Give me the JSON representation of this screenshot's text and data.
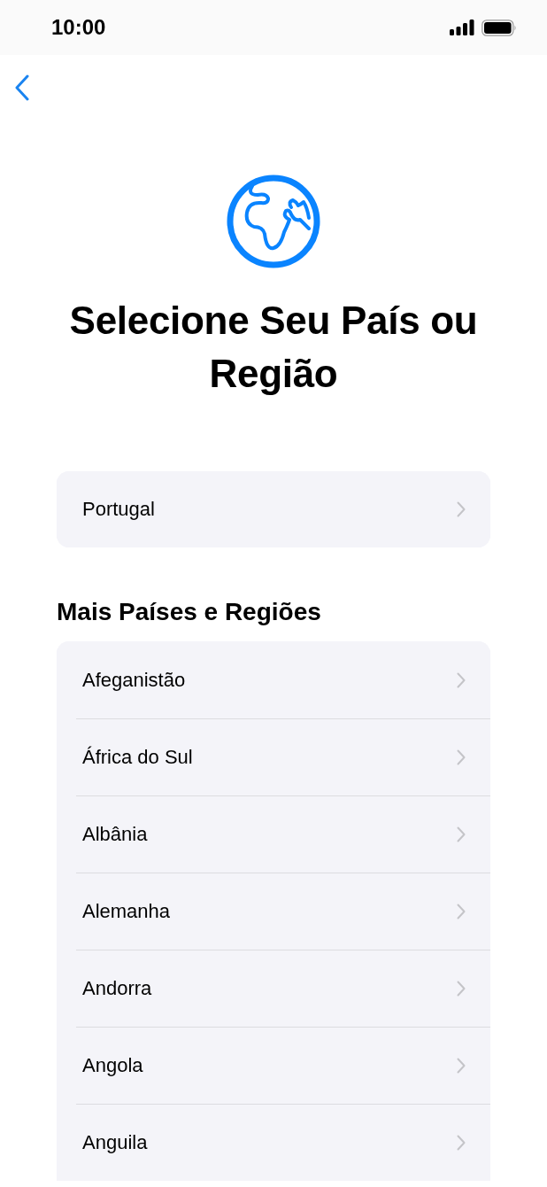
{
  "status_bar": {
    "time": "10:00"
  },
  "title": "Selecione Seu País ou Região",
  "suggested": [
    {
      "name": "Portugal"
    }
  ],
  "section_title": "Mais Países e Regiões",
  "countries": [
    {
      "name": "Afeganistão"
    },
    {
      "name": "África do Sul"
    },
    {
      "name": "Albânia"
    },
    {
      "name": "Alemanha"
    },
    {
      "name": "Andorra"
    },
    {
      "name": "Angola"
    },
    {
      "name": "Anguila"
    }
  ]
}
